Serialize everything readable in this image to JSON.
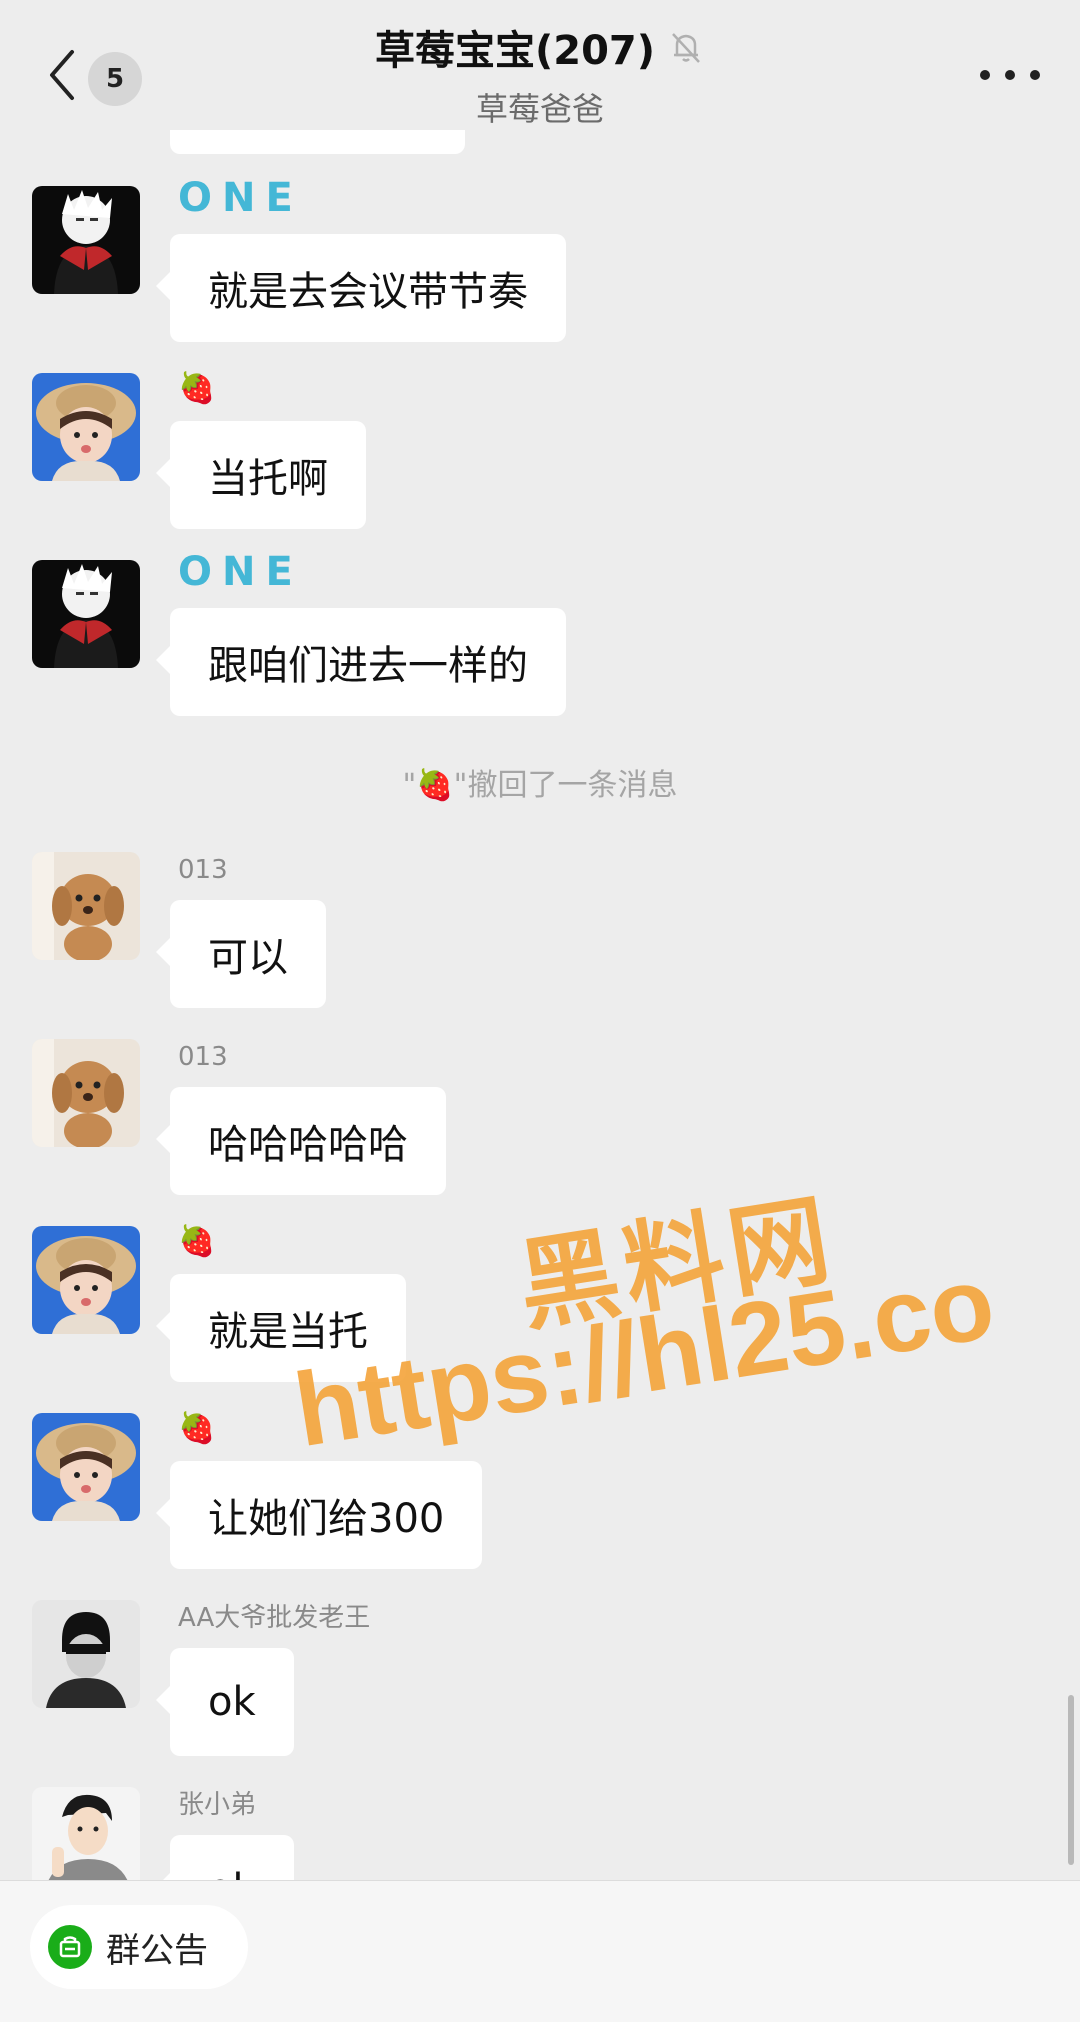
{
  "header": {
    "back_count": "5",
    "title": "草莓宝宝(207)",
    "subtitle": "草莓爸爸"
  },
  "messages": [
    {
      "sender": "ONE",
      "avatar": "anime-boy-avatar",
      "text": "就是去会议带节奏"
    },
    {
      "sender": "🍓",
      "avatar": "girl-straw-hat-avatar",
      "text": "当托啊"
    },
    {
      "sender": "ONE",
      "avatar": "anime-boy-avatar",
      "text": "跟咱们进去一样的"
    },
    {
      "sender": "013",
      "avatar": "puppy-avatar",
      "text": "可以"
    },
    {
      "sender": "013",
      "avatar": "puppy-avatar",
      "text": "哈哈哈哈哈"
    },
    {
      "sender": "🍓",
      "avatar": "girl-straw-hat-avatar",
      "text": "就是当托"
    },
    {
      "sender": "🍓",
      "avatar": "girl-straw-hat-avatar",
      "text": "让她们给300"
    },
    {
      "sender": "AA大爷批发老王",
      "avatar": "hooded-man-avatar",
      "text": "ok"
    },
    {
      "sender": "张小弟",
      "avatar": "cartoon-man-avatar",
      "text": "ok"
    }
  ],
  "system_note": {
    "quote_open": "\"",
    "name": "🍓",
    "quote_close": "\"",
    "text": "撤回了一条消息"
  },
  "watermark": {
    "chinese": "黑料网",
    "url": "https://hl25.co"
  },
  "bottom": {
    "announcement_label": "群公告"
  },
  "colors": {
    "background": "#ededed",
    "bubble": "#ffffff",
    "one_name": "#44b7d6",
    "watermark": "#f4a43a",
    "announce_icon": "#1aad19"
  }
}
